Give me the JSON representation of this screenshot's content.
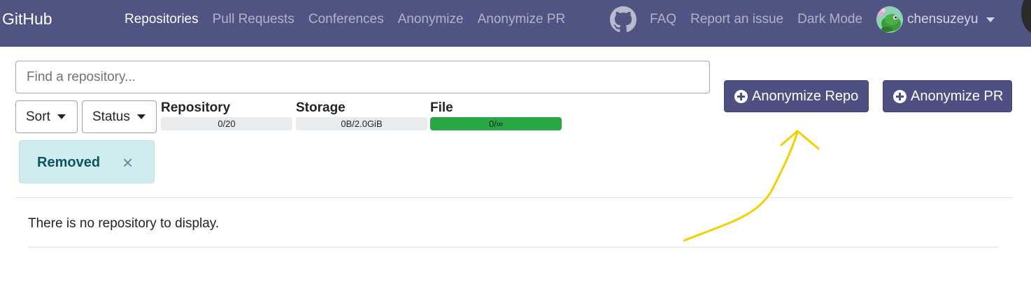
{
  "navbar": {
    "brand": "GitHub",
    "links": [
      {
        "label": "Repositories",
        "active": true
      },
      {
        "label": "Pull Requests",
        "active": false
      },
      {
        "label": "Conferences",
        "active": false
      },
      {
        "label": "Anonymize",
        "active": false
      },
      {
        "label": "Anonymize PR",
        "active": false
      }
    ],
    "right_links": [
      "FAQ",
      "Report an issue",
      "Dark Mode"
    ],
    "github_icon": "github-icon",
    "user": {
      "name": "chensuzeyu",
      "avatar_icon": "avatar"
    },
    "background_color": "#505483"
  },
  "search": {
    "placeholder": "Find a repository...",
    "value": ""
  },
  "filters": {
    "sort_label": "Sort",
    "status_label": "Status"
  },
  "quotas": [
    {
      "label": "Repository",
      "text": "0/20",
      "fill_fraction": 0
    },
    {
      "label": "Storage",
      "text": "0B/2.0GiB",
      "fill_fraction": 0
    },
    {
      "label": "File",
      "text": "0/∞",
      "fill_fraction": 1
    }
  ],
  "actions": {
    "anonymize_repo": "Anonymize Repo",
    "anonymize_pr": "Anonymize PR",
    "button_color": "#4d5080"
  },
  "active_filter": {
    "label": "Removed",
    "close_symbol": "×",
    "background_color": "#d1ecf1"
  },
  "list": {
    "empty_message": "There is no repository to display."
  },
  "annotation": {
    "type": "hand-drawn arrow",
    "color": "#f5d000",
    "points_to": "anonymize-repo-button"
  }
}
